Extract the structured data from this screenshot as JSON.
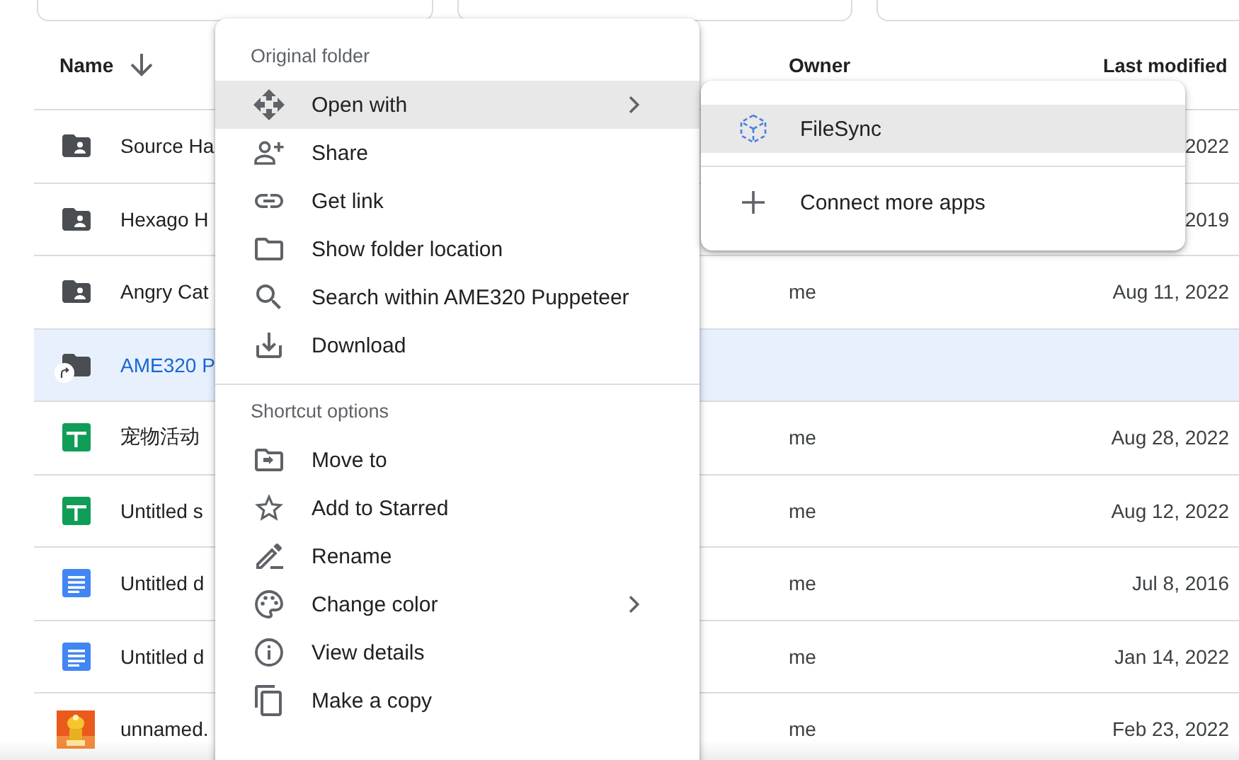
{
  "file_list": {
    "columns": [
      {
        "label": "Name",
        "sorted": true
      },
      {
        "label": "Owner",
        "sorted": false
      },
      {
        "label": "Last modified",
        "sorted": false
      }
    ],
    "rows": [
      {
        "kind": "shared-folder",
        "name": "Source Ha",
        "owner": "",
        "modified": "2022",
        "selected": false
      },
      {
        "kind": "shared-folder",
        "name": "Hexago H",
        "owner": "",
        "modified": "2019",
        "selected": false
      },
      {
        "kind": "shared-folder",
        "name": "Angry Cat",
        "owner": "me",
        "modified": "Aug 11, 2022",
        "selected": false
      },
      {
        "kind": "shortcut-folder",
        "name": "AME320 P",
        "owner": "",
        "modified": "",
        "selected": true
      },
      {
        "kind": "sheet",
        "name": "宠物活动",
        "owner": "me",
        "modified": "Aug 28, 2022",
        "selected": false
      },
      {
        "kind": "sheet",
        "name": "Untitled s",
        "owner": "me",
        "modified": "Aug 12, 2022",
        "selected": false
      },
      {
        "kind": "doc",
        "name": "Untitled d",
        "owner": "me",
        "modified": "Jul 8, 2016",
        "selected": false
      },
      {
        "kind": "doc",
        "name": "Untitled d",
        "owner": "me",
        "modified": "Jan 14, 2022",
        "selected": false
      },
      {
        "name": "unnamed.",
        "owner": "me",
        "modified": "Feb 23, 2022",
        "selected": false
      }
    ]
  },
  "context_menu": {
    "sections": [
      {
        "header": "Original folder",
        "items": [
          {
            "label": "Open with",
            "highlighted": true,
            "submenu": true
          },
          {
            "label": "Share",
            "highlighted": false,
            "submenu": false
          },
          {
            "label": "Get link",
            "highlighted": false,
            "submenu": false
          },
          {
            "label": "Show folder location",
            "highlighted": false,
            "submenu": false
          },
          {
            "label": "Search within AME320 Puppeteer",
            "highlighted": false,
            "submenu": false
          },
          {
            "label": "Download",
            "highlighted": false,
            "submenu": false
          }
        ]
      },
      {
        "header": "Shortcut options",
        "items": [
          {
            "label": "Move to",
            "highlighted": false,
            "submenu": false
          },
          {
            "label": "Add to Starred",
            "highlighted": false,
            "submenu": false
          },
          {
            "label": "Rename",
            "highlighted": false,
            "submenu": false
          },
          {
            "label": "Change color",
            "highlighted": false,
            "submenu": true
          },
          {
            "label": "View details",
            "highlighted": false,
            "submenu": false
          },
          {
            "label": "Make a copy",
            "highlighted": false,
            "submenu": false
          }
        ]
      }
    ]
  },
  "open_with_menu": {
    "sections": [
      {
        "items": [
          {
            "label": "FileSync",
            "highlighted": true,
            "submenu": false
          }
        ]
      },
      {
        "items": [
          {
            "label": "Connect more apps",
            "highlighted": false,
            "submenu": false
          }
        ]
      }
    ]
  }
}
